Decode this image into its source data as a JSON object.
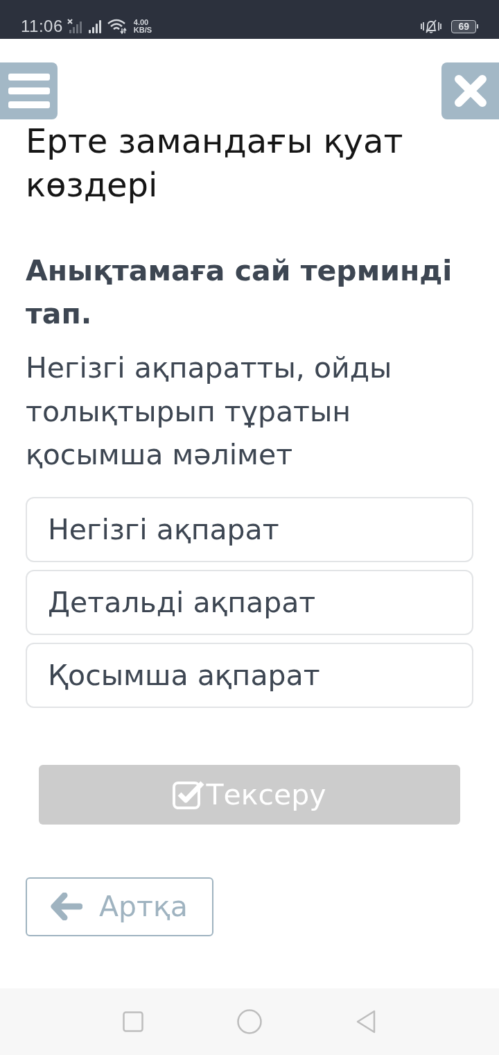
{
  "status_bar": {
    "time": "11:06",
    "speed_value": "4.00",
    "speed_unit": "KB/S",
    "battery": "69"
  },
  "title": "Ерте замандағы қуат көздері",
  "question": "Анықтамаға сай терминді тап.",
  "prompt": "Негізгі ақпаратты, ойды толықтырып тұратын қосымша мәлімет",
  "options": [
    {
      "label": "Негізгі ақпарат",
      "selected": false
    },
    {
      "label": "Детальді ақпарат",
      "selected": false
    },
    {
      "label": "Қосымша ақпарат",
      "selected": false
    }
  ],
  "check_button": {
    "label": "Тексеру",
    "disabled": true
  },
  "back_button": {
    "label": "Артқа"
  }
}
